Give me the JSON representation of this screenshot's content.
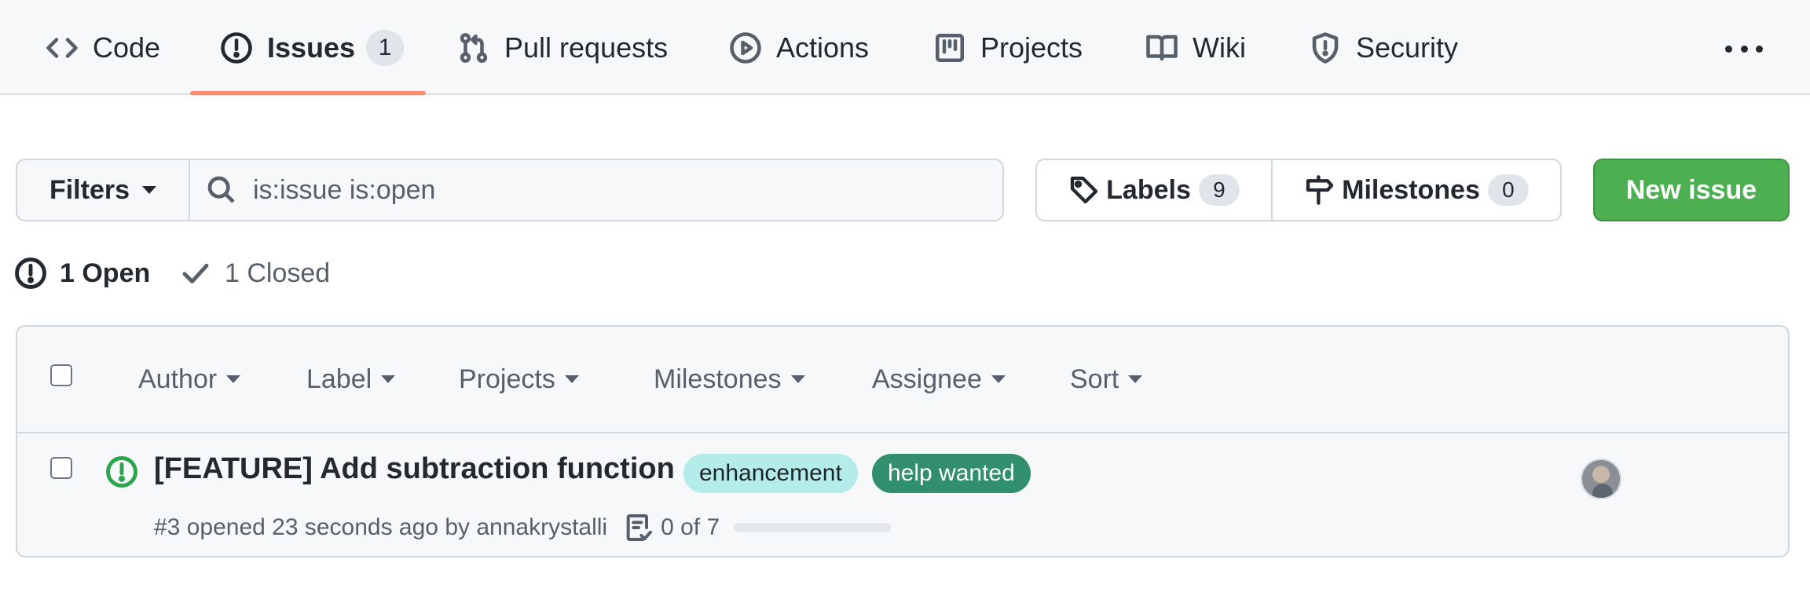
{
  "nav": {
    "items": [
      {
        "label": "Code",
        "icon": "code-icon"
      },
      {
        "label": "Issues",
        "icon": "issue-opened-icon",
        "count": "1",
        "active": true
      },
      {
        "label": "Pull requests",
        "icon": "git-pull-request-icon"
      },
      {
        "label": "Actions",
        "icon": "play-icon"
      },
      {
        "label": "Projects",
        "icon": "project-board-icon"
      },
      {
        "label": "Wiki",
        "icon": "book-icon"
      },
      {
        "label": "Security",
        "icon": "shield-icon"
      }
    ],
    "more_icon": "kebab-horizontal-icon",
    "underline_color": "#fd8c73"
  },
  "toolbar": {
    "filters_label": "Filters",
    "search_value": "is:issue is:open",
    "labels_label": "Labels",
    "labels_count": "9",
    "milestones_label": "Milestones",
    "milestones_count": "0",
    "new_issue_label": "New issue",
    "new_issue_color": "#4caf50"
  },
  "states": {
    "open_label": "1 Open",
    "closed_label": "1 Closed"
  },
  "list_header": {
    "filters": [
      "Author",
      "Label",
      "Projects",
      "Milestones",
      "Assignee",
      "Sort"
    ]
  },
  "issues": [
    {
      "title": "[FEATURE] Add subtraction function",
      "labels": [
        {
          "name": "enhancement",
          "bg": "#b3ece9",
          "fg": "#1f2328"
        },
        {
          "name": "help wanted",
          "bg": "#318f6d",
          "fg": "#ffffff"
        }
      ],
      "meta": "#3 opened 23 seconds ago by",
      "author": "annakrystalli",
      "tasks": "0 of 7",
      "progress": 0,
      "status_color": "#2da44e"
    }
  ]
}
